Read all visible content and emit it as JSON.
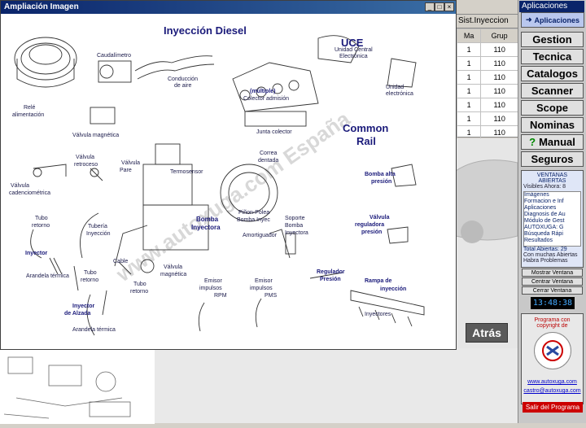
{
  "window": {
    "title": "Ampliación Imagen",
    "buttons": [
      "_",
      "□",
      "×"
    ]
  },
  "diagram": {
    "main_title": "Inyección Diesel",
    "section_ucd": "UCE",
    "section_common": "Common",
    "section_rail": "Rail",
    "watermark": "www.autoxuga.com España",
    "labels": {
      "caudalimetro": "Caudalímetro",
      "conduccion": "Conducción",
      "de_aire": "de aire",
      "uce_1": "Unidad Central",
      "uce_2": "Electrónica",
      "unidad_1": "Unidad",
      "unidad_2": "electrónica",
      "multiple": "(múltiple)",
      "colector_adm": "Colector admisión",
      "rele_1": "Relé",
      "rele_2": "alimentación",
      "valvula_magnetica": "Válvula magnética",
      "junta_colector": "Junta colector",
      "valvula_retroceso_1": "Válvula",
      "valvula_retroceso_2": "retroceso",
      "valvula_pare_1": "Válvula",
      "valvula_pare_2": "Pare",
      "termosensor": "Termosensor",
      "correa_1": "Correa",
      "correa_2": "dentada",
      "valvula_cadenc_1": "Válvula",
      "valvula_cadenc_2": "cadenciométrica",
      "bomba_alta_1": "Bomba alta",
      "bomba_alta_2": "presión",
      "tubo_retorno_1": "Tubo",
      "tubo_retorno_2": "retorno",
      "tuberia_1": "Tubería",
      "tuberia_2": "Inyección",
      "bomba_inyectora_1": "Bomba",
      "bomba_inyectora_2": "Inyectora",
      "pinon_1": "Piñon-Polea",
      "pinon_2": "Bomba Inyec",
      "soporte_1": "Soporte",
      "soporte_2": "Bomba",
      "soporte_3": "Inyectora",
      "valvula_reg_1": "Válvula",
      "valvula_reg_2": "reguladora",
      "valvula_reg_3": "presión",
      "inyector": "Inyector",
      "amortiguador": "Amortiguador",
      "arandela_termica": "Arandela térmica",
      "cable": "Cable",
      "valvula_mag2_1": "Válvula",
      "valvula_mag2_2": "magnética",
      "regulador_1": "Regulador",
      "regulador_2": "Presión",
      "rampa_1": "Rampa de",
      "rampa_2": "inyección",
      "tubo_retorno2_1": "Tubo",
      "tubo_retorno2_2": "retorno",
      "tubo_retorno3_1": "Tubo",
      "tubo_retorno3_2": "retorno",
      "emisor_rpm_1": "Emisor",
      "emisor_rpm_2": "impulsos",
      "emisor_rpm_3": "RPM",
      "emisor_pms_1": "Emisor",
      "emisor_pms_2": "impulsos",
      "emisor_pms_3": "PMS",
      "inyector_alzada_1": "Inyector",
      "inyector_alzada_2": "de Alzada",
      "arandela_termica2": "Arandela térmica",
      "inyectores": "Inyectores"
    }
  },
  "background": {
    "atras_label": "Atrás",
    "table_title": "Sist.Inyeccion",
    "table_headers": [
      "Ma",
      "Grup"
    ],
    "table_rows": [
      [
        "1",
        "110"
      ],
      [
        "1",
        "110"
      ],
      [
        "1",
        "110"
      ],
      [
        "1",
        "110"
      ],
      [
        "1",
        "110"
      ],
      [
        "1",
        "110"
      ],
      [
        "1",
        "110"
      ]
    ]
  },
  "right_panel": {
    "title": "Aplicaciones",
    "tab_label": "Aplicaciones",
    "buttons": [
      "Gestion",
      "Tecnica",
      "Catalogos",
      "Scanner",
      "Scope",
      "Nominas",
      "Manual",
      "Seguros"
    ],
    "ventanas_title": "VENTANAS ABIERTAS",
    "visibles": "Visibles Ahora: 8",
    "windows": [
      "Imágenes",
      "Formacion e Inf",
      "Aplicaciones",
      "Diagnosis de Au",
      "Módulo de Gest",
      "AUTOXUGA: G",
      "Búsqueda Rápi",
      "Resultados"
    ],
    "total": "Total Abiertas: 29",
    "muchas": "Con muchas Abiertas",
    "problemas": "Habra Problemas",
    "mostrar": "Mostrar Ventana",
    "centrar": "Centrar Ventana",
    "cerrar": "Cerrar Ventana",
    "clock": "13:48:38",
    "copyright_1": "Programa con",
    "copyright_2": "copyright de",
    "web": "www.autoxuga.com",
    "email": "castro@autoxuga.com",
    "salir": "Salir del Programa"
  },
  "colors": {
    "title_bar": "#0a246a",
    "label_blue": "#1a1a7a",
    "salir_red": "#cc0000"
  }
}
